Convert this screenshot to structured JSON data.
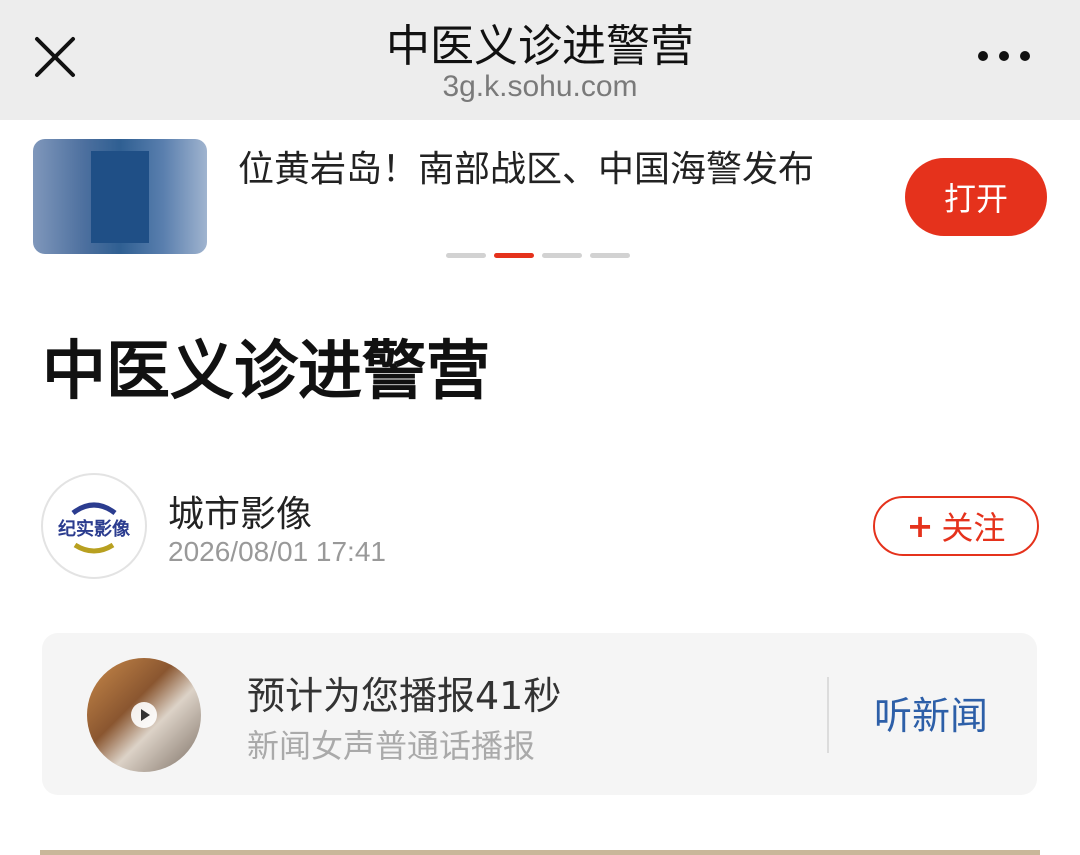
{
  "topbar": {
    "title": "中医义诊进警营",
    "url": "3g.k.sohu.com",
    "close_icon": "close-icon",
    "more_icon": "more-icon"
  },
  "promo": {
    "headline": "位黄岩岛！南部战区、中国海警发布",
    "open_label": "打开",
    "carousel_active_index": 1,
    "carousel_count": 4
  },
  "article": {
    "title": "中医义诊进警营"
  },
  "author": {
    "name": "城市影像",
    "time": "2026/08/01 17:41",
    "avatar_logo": "纪实影像",
    "follow_label": "关注",
    "follow_icon": "+"
  },
  "listen": {
    "title": "预计为您播报41秒",
    "subtitle": "新闻女声普通话播报",
    "button_label": "听新闻",
    "play_icon": "play-icon"
  },
  "colors": {
    "accent_red": "#e5321c",
    "link_blue": "#2d5fa8",
    "topbar_bg": "#ededed"
  }
}
